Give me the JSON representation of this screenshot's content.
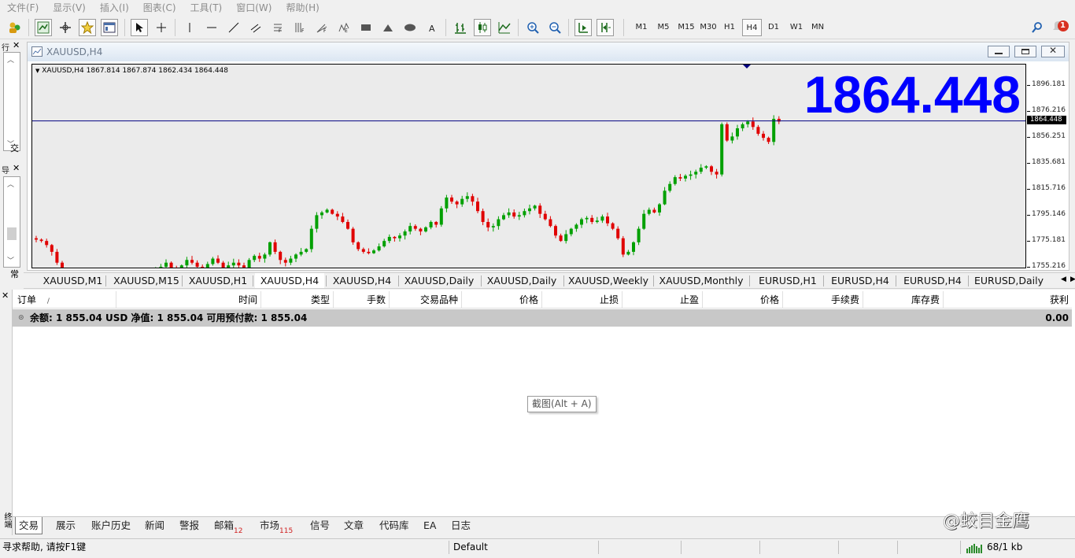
{
  "menu": [
    "文件(F)",
    "显示(V)",
    "插入(I)",
    "图表(C)",
    "工具(T)",
    "窗口(W)",
    "帮助(H)"
  ],
  "toolbar": {
    "timeframes": [
      "M1",
      "M5",
      "M15",
      "M30",
      "H1",
      "H4",
      "D1",
      "W1",
      "MN"
    ],
    "active_timeframe": "H4",
    "notification_count": "1"
  },
  "left_panel": {
    "tab_top": "交",
    "tab_bottom": "常"
  },
  "chart": {
    "window_title": "XAUUSD,H4",
    "info_symbol": "XAUUSD,H4",
    "info_ohlc": "1867.814 1867.874 1862.434 1864.448",
    "current_price": "1864.448",
    "price_labels": [
      "1896.181",
      "1876.216",
      "1856.251",
      "1835.681",
      "1815.716",
      "1795.146",
      "1775.181",
      "1755.216"
    ],
    "colors": {
      "up": "#00a000",
      "down": "#e00000",
      "price_line": "#000080",
      "background": "#ebebeb",
      "big_price": "#0000ff"
    }
  },
  "chart_data": {
    "type": "candlestick",
    "symbol": "XAUUSD",
    "timeframe": "H4",
    "ylim": [
      1755.216,
      1906.0
    ],
    "current_price": 1864.448,
    "closes": [
      1777,
      1776,
      1773,
      1768,
      1760,
      1752,
      1748,
      1749,
      1753,
      1751,
      1750,
      1749,
      1752,
      1753,
      1752,
      1750,
      1748,
      1746,
      1749,
      1752,
      1751,
      1749,
      1752,
      1755,
      1757,
      1760,
      1756,
      1753,
      1758,
      1762,
      1760,
      1757,
      1755,
      1759,
      1763,
      1760,
      1755,
      1758,
      1760,
      1758,
      1756,
      1762,
      1765,
      1763,
      1766,
      1775,
      1768,
      1762,
      1760,
      1763,
      1766,
      1768,
      1770,
      1785,
      1795,
      1797,
      1799,
      1796,
      1794,
      1790,
      1785,
      1775,
      1770,
      1768,
      1767,
      1769,
      1772,
      1776,
      1779,
      1778,
      1780,
      1783,
      1787,
      1785,
      1783,
      1786,
      1790,
      1788,
      1800,
      1808,
      1805,
      1803,
      1807,
      1809,
      1805,
      1798,
      1790,
      1786,
      1787,
      1792,
      1795,
      1797,
      1794,
      1795,
      1798,
      1800,
      1802,
      1796,
      1792,
      1787,
      1780,
      1776,
      1781,
      1785,
      1788,
      1792,
      1793,
      1790,
      1791,
      1794,
      1789,
      1785,
      1778,
      1766,
      1768,
      1775,
      1785,
      1796,
      1799,
      1797,
      1803,
      1813,
      1818,
      1823,
      1822,
      1824,
      1825,
      1827,
      1830,
      1831,
      1827,
      1825,
      1862,
      1850,
      1853,
      1859,
      1862,
      1864,
      1860,
      1855,
      1852,
      1849,
      1866,
      1864
    ]
  },
  "chart_tabs": [
    "XAUUSD,M1",
    "XAUUSD,M15",
    "XAUUSD,H1",
    "XAUUSD,H4",
    "XAUUSD,H4",
    "XAUUSD,Daily",
    "XAUUSD,Daily",
    "XAUUSD,Weekly",
    "XAUUSD,Monthly",
    "EURUSD,H1",
    "EURUSD,H4",
    "EURUSD,H4",
    "EURUSD,Daily"
  ],
  "terminal": {
    "columns": [
      "订单",
      "时间",
      "类型",
      "手数",
      "交易品种",
      "价格",
      "止损",
      "止盈",
      "价格",
      "手续费",
      "库存费",
      "获利"
    ],
    "sort_mark": "/",
    "balance_text": "余额: 1 855.04 USD  净值: 1 855.04  可用预付款: 1 855.04",
    "balance_profit": "0.00",
    "tooltip": "截图(Alt + A)",
    "side_label": "终端",
    "tabs": [
      {
        "label": "交易",
        "badge": ""
      },
      {
        "label": "展示",
        "badge": ""
      },
      {
        "label": "账户历史",
        "badge": ""
      },
      {
        "label": "新闻",
        "badge": ""
      },
      {
        "label": "警报",
        "badge": ""
      },
      {
        "label": "邮箱",
        "badge": "12"
      },
      {
        "label": "市场",
        "badge": "115"
      },
      {
        "label": "信号",
        "badge": ""
      },
      {
        "label": "文章",
        "badge": ""
      },
      {
        "label": "代码库",
        "badge": ""
      },
      {
        "label": "EA",
        "badge": ""
      },
      {
        "label": "日志",
        "badge": ""
      }
    ]
  },
  "watermark": "@蛟目金鹰",
  "status": {
    "help": "寻求帮助, 请按F1键",
    "profile": "Default",
    "traffic": "68/1 kb"
  }
}
